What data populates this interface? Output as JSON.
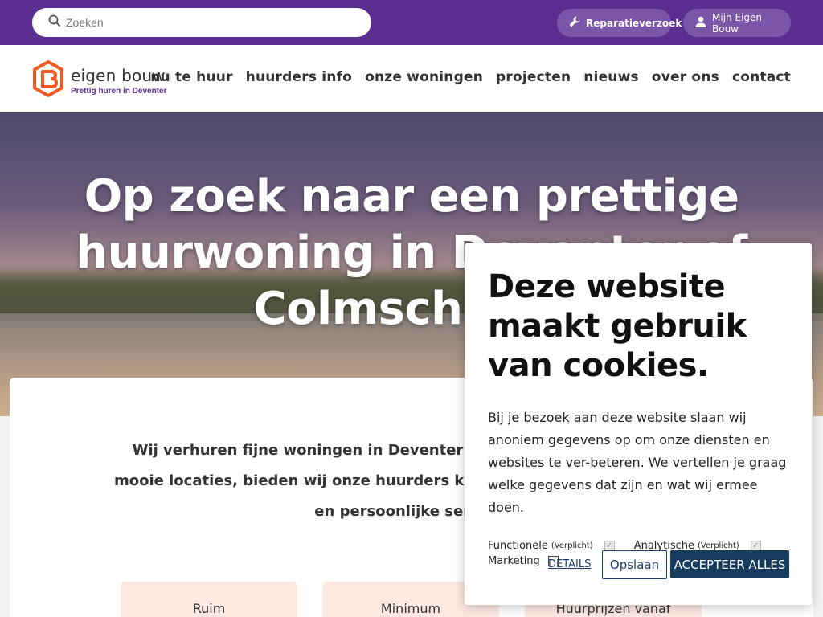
{
  "topbar": {
    "search_placeholder": "Zoeken",
    "repair_label": "Reparatieverzoek",
    "account_label": "Mijn Eigen Bouw"
  },
  "header": {
    "logo_name": "eigen bouw",
    "logo_tagline": "Prettig huren in Deventer",
    "nav": [
      "nu te huur",
      "huurders info",
      "onze woningen",
      "projecten",
      "nieuws",
      "over ons",
      "contact"
    ]
  },
  "hero": {
    "title": "Op zoek naar een prettige huurwoning in Deventer of Colmschate?"
  },
  "intro": {
    "text": "Wij verhuren fijne woningen in Deventer en Colmschate. Gelegen op mooie locaties, bieden wij onze huurders kwaliteit voor een eerlijke prijs en persoonlijke service."
  },
  "usps": [
    "Ruim",
    "Minimum",
    "Huurprijzen vanaf"
  ],
  "cookie": {
    "title": "Deze website maakt gebruik van cookies.",
    "body": "Bij je bezoek aan deze website slaan wij anoniem gegevens op om onze diensten en websites te ver-beteren. We vertellen je graag welke gegevens dat zijn en wat wij ermee doen.",
    "options": [
      {
        "label": "Functionele",
        "note": "(Verplicht)",
        "checked": true,
        "disabled": true
      },
      {
        "label": "Analytische",
        "note": "(Verplicht)",
        "checked": true,
        "disabled": true
      },
      {
        "label": "Marketing",
        "note": "",
        "checked": false,
        "disabled": false
      }
    ],
    "details_label": "DETAILS",
    "save_label": "Opslaan",
    "accept_label": "ACCEPTEER ALLES"
  },
  "colors": {
    "topbar": "#5c2d91",
    "logo_orange": "#f05a22",
    "accept_button": "#173b5c",
    "usp_bg": "#fde9e2"
  }
}
